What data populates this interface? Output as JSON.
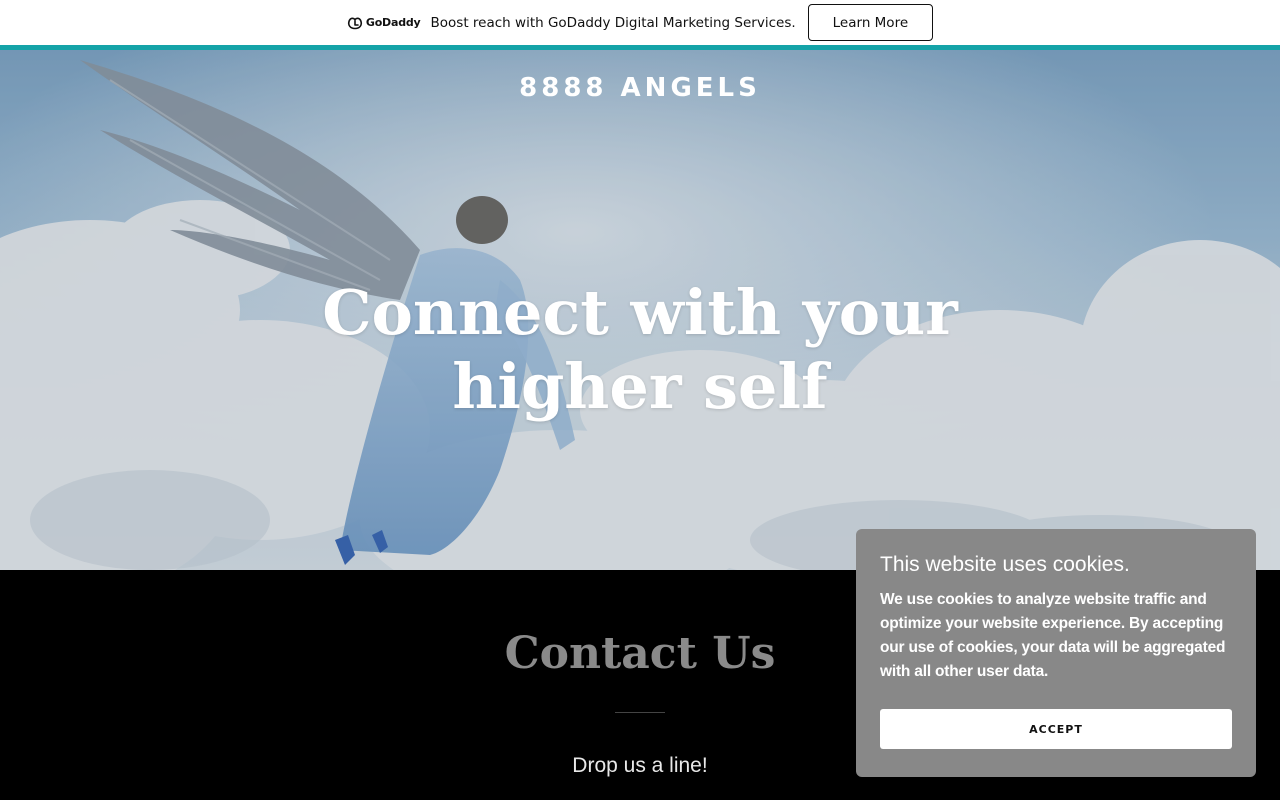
{
  "promo_bar": {
    "logo_text": "GoDaddy",
    "message": "Boost reach with GoDaddy Digital Marketing Services.",
    "button_label": "Learn More",
    "accent_color": "#14a3a8"
  },
  "hero": {
    "site_title": "8888 ANGELS",
    "heading": "Connect with your higher self"
  },
  "contact": {
    "title": "Contact Us",
    "subtitle": "Drop us a line!"
  },
  "cookie_banner": {
    "title": "This website uses cookies.",
    "text": "We use cookies to analyze website traffic and optimize your website experience. By accepting our use of cookies, your data will be aggregated with all other user data.",
    "accept_label": "ACCEPT",
    "background_color": "#888888"
  }
}
